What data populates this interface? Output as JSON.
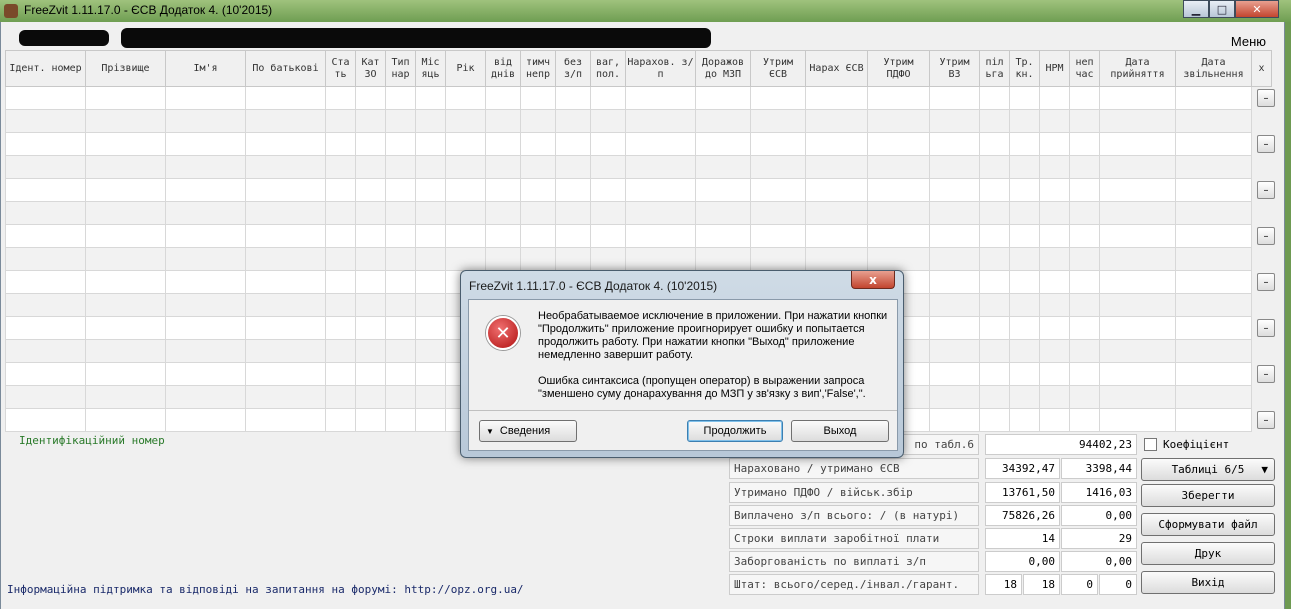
{
  "window": {
    "title": "FreeZvit 1.11.17.0 - ЄСВ Додаток 4. (10'2015)",
    "minimize": "▁",
    "maximize": "□",
    "close": "✕"
  },
  "menu": {
    "label": "Меню"
  },
  "table": {
    "columns": [
      {
        "label": "Ідент. номер",
        "width": 80
      },
      {
        "label": "Прізвище",
        "width": 80
      },
      {
        "label": "Ім'я",
        "width": 80
      },
      {
        "label": "По батькові",
        "width": 80
      },
      {
        "label": "Ста ть",
        "width": 30
      },
      {
        "label": "Кат ЗО",
        "width": 30
      },
      {
        "label": "Тип нар",
        "width": 30
      },
      {
        "label": "Міс яць",
        "width": 30
      },
      {
        "label": "Рік",
        "width": 40
      },
      {
        "label": "від днів",
        "width": 35
      },
      {
        "label": "тимч непр",
        "width": 35
      },
      {
        "label": "без з/п",
        "width": 35
      },
      {
        "label": "ваг, пол.",
        "width": 35
      },
      {
        "label": "Нарахов. з/п",
        "width": 70
      },
      {
        "label": "Доражов до МЗП",
        "width": 55
      },
      {
        "label": "Утрим ЄСВ",
        "width": 55
      },
      {
        "label": "Нарах ЄСВ",
        "width": 62
      },
      {
        "label": "Утрим ПДФО",
        "width": 62
      },
      {
        "label": "Утрим ВЗ",
        "width": 50
      },
      {
        "label": "піл ьга",
        "width": 30
      },
      {
        "label": "Тр. кн.",
        "width": 30
      },
      {
        "label": "НРМ",
        "width": 30
      },
      {
        "label": "неп час",
        "width": 30
      },
      {
        "label": "Дата прийняття",
        "width": 76
      },
      {
        "label": "Дата звільнення",
        "width": 76
      },
      {
        "label": "х",
        "width": 20
      }
    ],
    "row_count": 15,
    "delete_label": "–"
  },
  "status": {
    "id_label": "Ідентифікаційний номер",
    "support": "Інформаційна підтримка та відповіді на запитання на форумі: http://opz.org.ua/"
  },
  "summary": {
    "row1": {
      "label": "по табл.6",
      "value": "94402,23"
    },
    "row2": {
      "label": "Нараховано / утримано ЄСВ",
      "v1": "34392,47",
      "v2": "3398,44"
    },
    "row3": {
      "label": "Утримано ПДФО / військ.збір",
      "v1": "13761,50",
      "v2": "1416,03"
    },
    "row4": {
      "label": "Виплачено з/п всього: / (в натурі)",
      "v1": "75826,26",
      "v2": "0,00"
    },
    "row5": {
      "label": "Строки виплати заробітної плати",
      "v1": "14",
      "v2": "29"
    },
    "row6": {
      "label": "Заборгованість по виплаті з/п",
      "v1": "0,00",
      "v2": "0,00"
    },
    "row7": {
      "label": "Штат: всього/серед./інвал./гарант.",
      "v1": "18",
      "v2": "18",
      "v3": "0",
      "v4": "0"
    }
  },
  "buttons": {
    "coef": "Коефіцієнт",
    "tables": "Таблиці 6/5",
    "save": "Зберегти",
    "form_file": "Сформувати файл",
    "print": "Друк",
    "exit": "Вихід"
  },
  "dialog": {
    "title": "FreeZvit 1.11.17.0 - ЄСВ Додаток 4. (10'2015)",
    "close": "x",
    "message1": "Необрабатываемое исключение в приложении. При нажатии кнопки \"Продолжить\" приложение проигнорирует ошибку и попытается продолжить работу. При нажатии кнопки \"Выход\" приложение немедленно завершит работу.",
    "message2": "Ошибка синтаксиса (пропущен оператор) в выражении запроса \"зменшено суму донарахування до МЗП у зв'язку з вип','False',\".",
    "details": "Сведения",
    "continue": "Продолжить",
    "exit": "Выход"
  }
}
